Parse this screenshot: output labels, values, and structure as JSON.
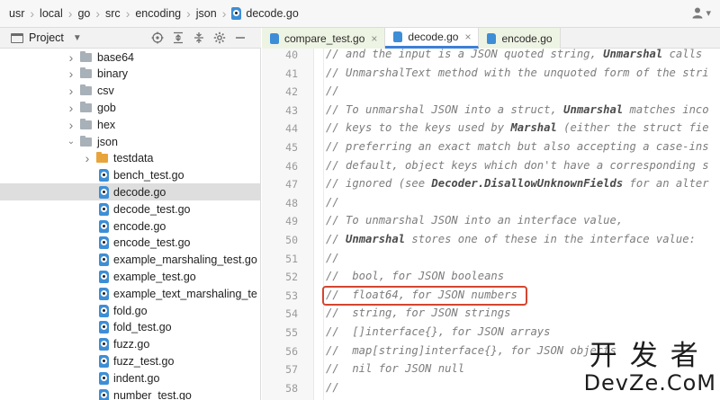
{
  "breadcrumb": {
    "items": [
      "usr",
      "local",
      "go",
      "src",
      "encoding",
      "json",
      "decode.go"
    ]
  },
  "project_panel": {
    "title": "Project",
    "tree": [
      {
        "label": "base64",
        "kind": "folder",
        "expanded": false
      },
      {
        "label": "binary",
        "kind": "folder",
        "expanded": false
      },
      {
        "label": "csv",
        "kind": "folder",
        "expanded": false
      },
      {
        "label": "gob",
        "kind": "folder",
        "expanded": false
      },
      {
        "label": "hex",
        "kind": "folder",
        "expanded": false
      },
      {
        "label": "json",
        "kind": "folder",
        "expanded": true
      },
      {
        "label": "testdata",
        "kind": "folder-orange",
        "expanded": false
      },
      {
        "label": "bench_test.go",
        "kind": "go-file"
      },
      {
        "label": "decode.go",
        "kind": "go-file",
        "selected": true
      },
      {
        "label": "decode_test.go",
        "kind": "go-file"
      },
      {
        "label": "encode.go",
        "kind": "go-file"
      },
      {
        "label": "encode_test.go",
        "kind": "go-file"
      },
      {
        "label": "example_marshaling_test.go",
        "kind": "go-file"
      },
      {
        "label": "example_test.go",
        "kind": "go-file"
      },
      {
        "label": "example_text_marshaling_te",
        "kind": "go-file"
      },
      {
        "label": "fold.go",
        "kind": "go-file"
      },
      {
        "label": "fold_test.go",
        "kind": "go-file"
      },
      {
        "label": "fuzz.go",
        "kind": "go-file"
      },
      {
        "label": "fuzz_test.go",
        "kind": "go-file"
      },
      {
        "label": "indent.go",
        "kind": "go-file"
      },
      {
        "label": "number_test.go",
        "kind": "go-file"
      }
    ]
  },
  "tabs": [
    {
      "label": "compare_test.go",
      "active": false
    },
    {
      "label": "decode.go",
      "active": true
    },
    {
      "label": "encode.go",
      "active": false
    }
  ],
  "editor": {
    "lines": [
      {
        "num": "40",
        "segments": [
          {
            "t": "// and the input is a JSON quoted string, "
          },
          {
            "t": "Unmarshal",
            "b": true
          },
          {
            "t": " calls"
          }
        ]
      },
      {
        "num": "41",
        "segments": [
          {
            "t": "// UnmarshalText method with the unquoted form of the stri"
          }
        ]
      },
      {
        "num": "42",
        "segments": [
          {
            "t": "//"
          }
        ]
      },
      {
        "num": "43",
        "segments": [
          {
            "t": "// To unmarshal JSON into a struct, "
          },
          {
            "t": "Unmarshal",
            "b": true
          },
          {
            "t": " matches inco"
          }
        ]
      },
      {
        "num": "44",
        "segments": [
          {
            "t": "// keys to the keys used by "
          },
          {
            "t": "Marshal",
            "b": true
          },
          {
            "t": " (either the struct fie"
          }
        ]
      },
      {
        "num": "45",
        "segments": [
          {
            "t": "// preferring an exact match but also accepting a case-ins"
          }
        ]
      },
      {
        "num": "46",
        "segments": [
          {
            "t": "// default, object keys which don't have a corresponding s"
          }
        ]
      },
      {
        "num": "47",
        "segments": [
          {
            "t": "// ignored (see "
          },
          {
            "t": "Decoder.DisallowUnknownFields",
            "b": true
          },
          {
            "t": " for an alter"
          }
        ]
      },
      {
        "num": "48",
        "segments": [
          {
            "t": "//"
          }
        ]
      },
      {
        "num": "49",
        "segments": [
          {
            "t": "// To unmarshal JSON into an interface value,"
          }
        ]
      },
      {
        "num": "50",
        "segments": [
          {
            "t": "// "
          },
          {
            "t": "Unmarshal",
            "b": true
          },
          {
            "t": " stores one of these in the interface value:"
          }
        ]
      },
      {
        "num": "51",
        "segments": [
          {
            "t": "//"
          }
        ]
      },
      {
        "num": "52",
        "segments": [
          {
            "t": "//  bool, for JSON booleans"
          }
        ]
      },
      {
        "num": "53",
        "segments": [
          {
            "t": "//  float64, for JSON numbers"
          }
        ]
      },
      {
        "num": "54",
        "segments": [
          {
            "t": "//  string, for JSON strings"
          }
        ]
      },
      {
        "num": "55",
        "segments": [
          {
            "t": "//  []interface{}, for JSON arrays"
          }
        ]
      },
      {
        "num": "56",
        "segments": [
          {
            "t": "//  map[string]interface{}, for JSON objects"
          }
        ]
      },
      {
        "num": "57",
        "segments": [
          {
            "t": "//  nil for JSON null"
          }
        ]
      },
      {
        "num": "58",
        "segments": [
          {
            "t": "//"
          }
        ]
      }
    ],
    "highlighted_line": "53"
  },
  "watermark": {
    "cn": "开发者",
    "en": "DevZe.CoM"
  },
  "colors": {
    "accent": "#3c7fd6",
    "highlight_box": "#d4462f",
    "go_icon": "#3d8ed6",
    "folder": "#a8b0b8",
    "folder_testdata": "#e8a43c"
  }
}
